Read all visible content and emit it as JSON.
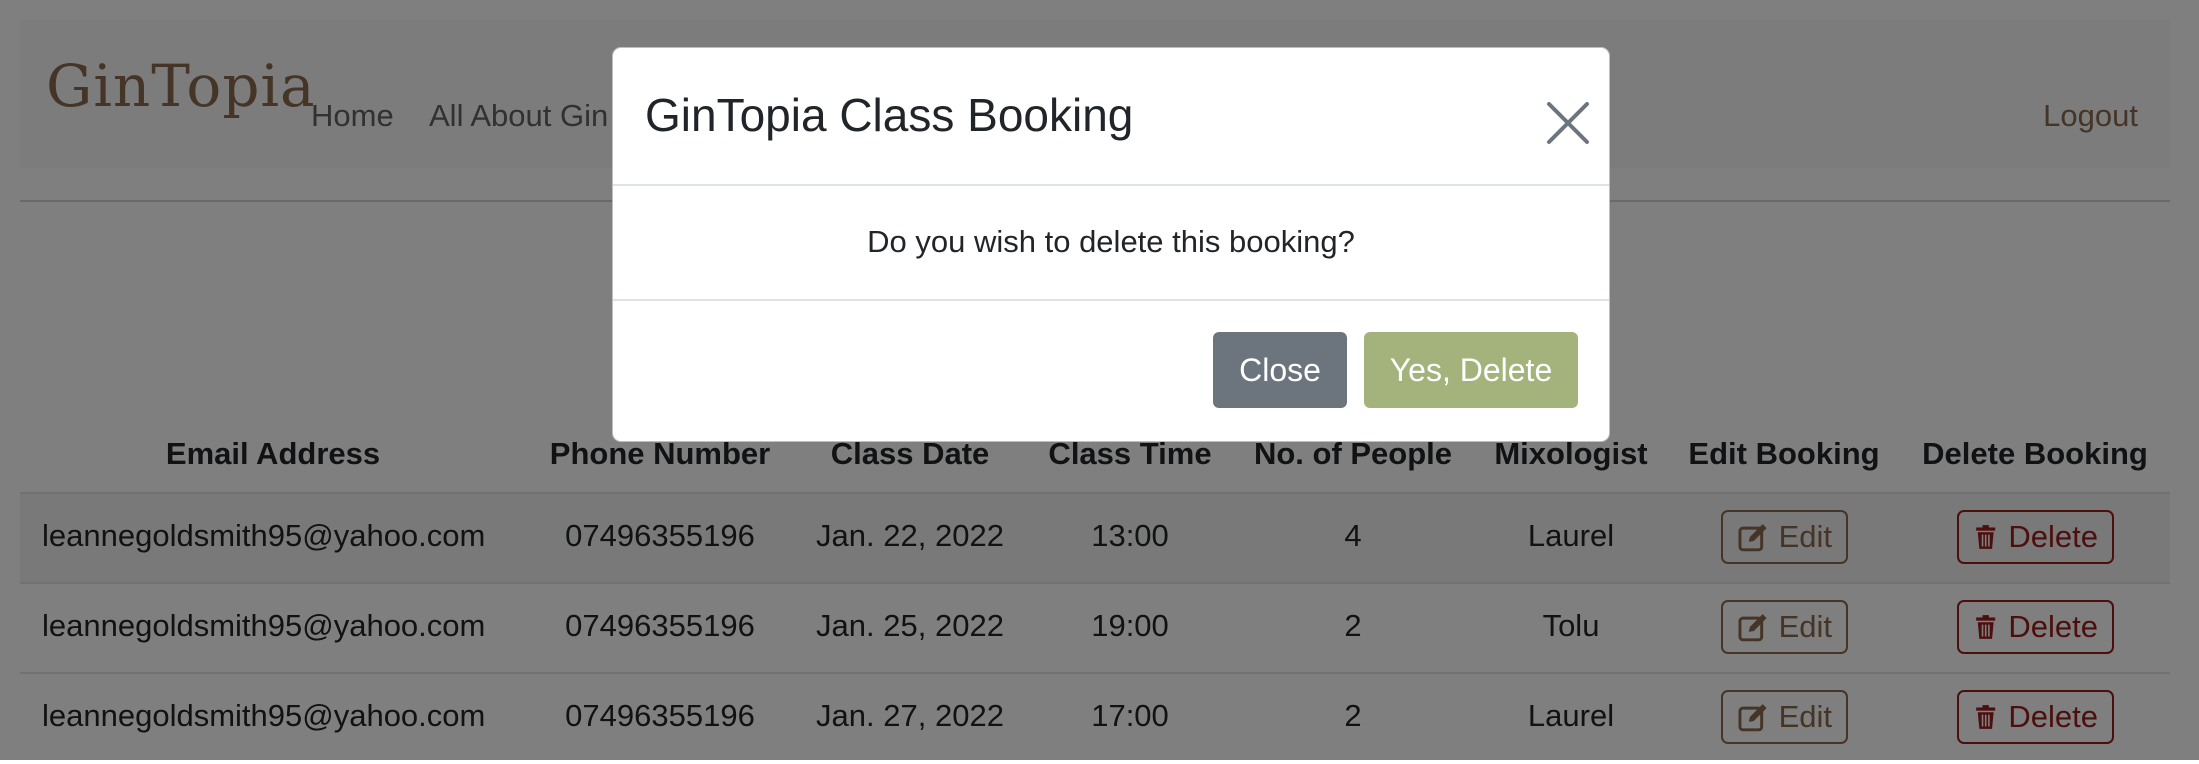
{
  "navbar": {
    "brand": "GinTopia",
    "links": [
      "Home",
      "All About Gin"
    ],
    "logout": "Logout"
  },
  "table": {
    "headers": [
      "Email Address",
      "Phone Number",
      "Class Date",
      "Class Time",
      "No. of People",
      "Mixologist",
      "Edit Booking",
      "Delete Booking"
    ],
    "rows": [
      {
        "email": "leannegoldsmith95@yahoo.com",
        "phone": "07496355196",
        "date": "Jan. 22, 2022",
        "time": "13:00",
        "people": "4",
        "mixologist": "Laurel",
        "edit": "Edit",
        "delete": "Delete"
      },
      {
        "email": "leannegoldsmith95@yahoo.com",
        "phone": "07496355196",
        "date": "Jan. 25, 2022",
        "time": "19:00",
        "people": "2",
        "mixologist": "Tolu",
        "edit": "Edit",
        "delete": "Delete"
      },
      {
        "email": "leannegoldsmith95@yahoo.com",
        "phone": "07496355196",
        "date": "Jan. 27, 2022",
        "time": "17:00",
        "people": "2",
        "mixologist": "Laurel",
        "edit": "Edit",
        "delete": "Delete"
      }
    ]
  },
  "modal": {
    "title": "GinTopia Class Booking",
    "message": "Do you wish to delete this booking?",
    "close_label": "Close",
    "confirm_label": "Yes, Delete"
  },
  "icons": {
    "edit": "edit-icon",
    "delete": "trash-icon",
    "modal_close": "close-icon"
  },
  "colors": {
    "brand": "#8b6a4e",
    "danger": "#9b1c1c",
    "confirm": "#a4b37b",
    "secondary": "#6c757d"
  }
}
